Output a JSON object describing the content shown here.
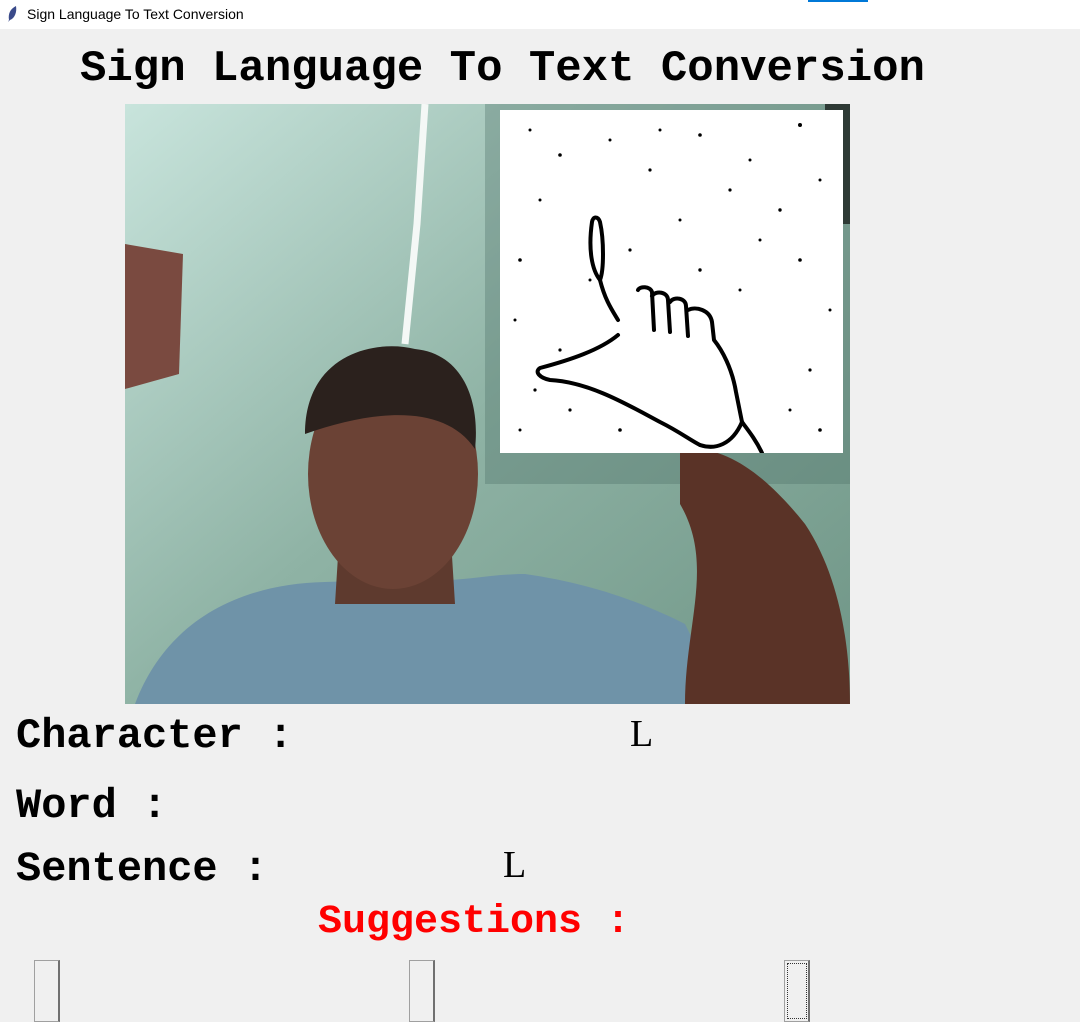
{
  "window": {
    "title": "Sign Language To Text Conversion"
  },
  "heading": "Sign Language To Text Conversion",
  "labels": {
    "character": "Character :",
    "word": "Word :",
    "sentence": "Sentence :",
    "suggestions": "Suggestions :"
  },
  "values": {
    "character": "L",
    "word": "",
    "sentence": "L"
  },
  "suggestion_buttons": [
    "",
    "",
    ""
  ],
  "colors": {
    "suggestions": "#ff0000",
    "background": "#f0f0f0"
  },
  "icons": {
    "app": "feather-icon"
  }
}
